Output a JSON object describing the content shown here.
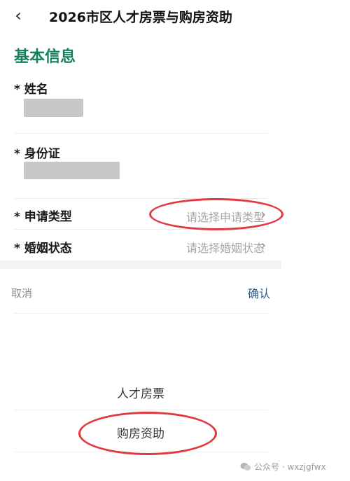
{
  "header": {
    "back_icon": "chevron-left-icon",
    "title": "2026市区人才房票与购房资助"
  },
  "section": {
    "title": "基本信息"
  },
  "fields": {
    "name": {
      "label": "* 姓名"
    },
    "id_card": {
      "label": "* 身份证"
    },
    "apply_type": {
      "label": "* 申请类型",
      "placeholder": "请选择申请类型"
    },
    "marital": {
      "label": "* 婚姻状态",
      "placeholder": "请选择婚姻状态"
    }
  },
  "picker": {
    "cancel_label": "取消",
    "confirm_label": "确认",
    "options": [
      "人才房票",
      "购房资助"
    ]
  },
  "annotation": {
    "color": "#e0393f"
  },
  "watermark": {
    "text": "公众号 · wxzjgfwx"
  },
  "colors": {
    "section_title": "#15805f",
    "confirm": "#2b5a8a"
  }
}
